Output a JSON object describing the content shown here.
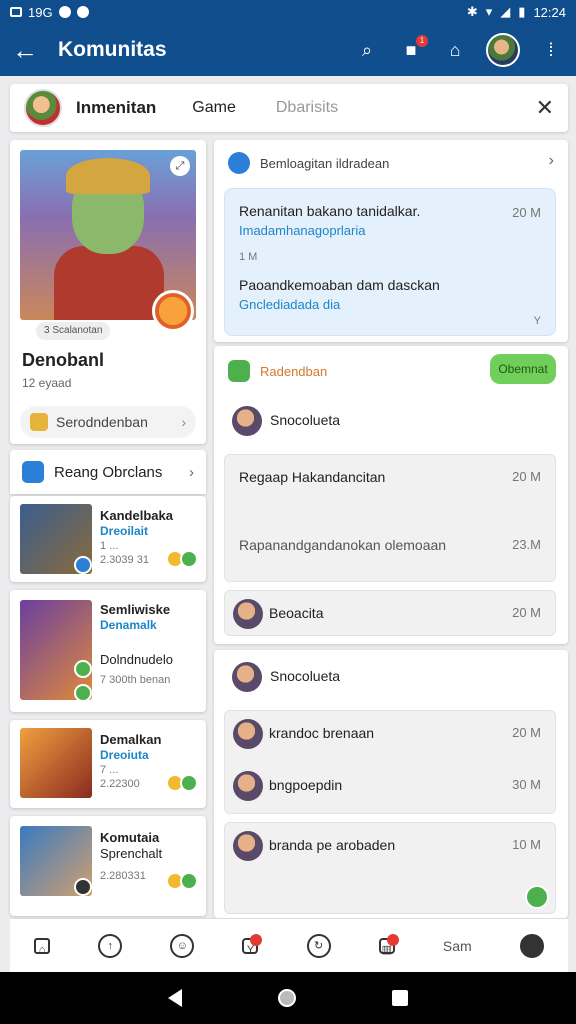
{
  "status_bar": {
    "left_text": "19G",
    "time": "12:24"
  },
  "app_bar": {
    "title": "Komunitas",
    "back_icon": "←",
    "notification_badge": "1"
  },
  "tabs": [
    {
      "label": "Inmenitan"
    },
    {
      "label": "Game"
    },
    {
      "label": "Dbarisits"
    }
  ],
  "profile": {
    "chip": "3 Scalanotan",
    "name": "Denobanl",
    "sub": "12 eyaad",
    "row_label": "Serodndenban"
  },
  "recommend": {
    "title": "Reang Obrclans"
  },
  "games": [
    {
      "title": "Kandelbaka",
      "sub": "Dreoilait",
      "meta1": "1 ...",
      "meta2": "2.3039 31"
    },
    {
      "title": "Semliwiske",
      "sub": "Denamalk",
      "meta1": "Dolndnudelo",
      "meta2": "7 300th benan"
    },
    {
      "title": "Demalkan",
      "sub": "Dreoiuta",
      "meta1": "7 ...",
      "meta2": "2.22300"
    },
    {
      "title": "Komutaia",
      "sub": "Sprenchalt",
      "meta1": "2.280331",
      "meta2": ""
    }
  ],
  "notice": {
    "head": "Bemloagitan ildradean",
    "line1": "Renanitan bakano tanidalkar.",
    "link1": "Imadamhanagoprlaria",
    "time1": "20 M",
    "small": "1 M",
    "line2": "Paoandkemoaban dam dasckan",
    "link2": "Gnclediadada dia",
    "foot": "Y"
  },
  "section1": {
    "head": "Radendban",
    "button": "Obemnat",
    "user": "Snocolueta",
    "item1": {
      "text": "Regaap Hakandancitan",
      "time": "20 M"
    },
    "item2": {
      "text": "Rapanandgandanokan olemoaan",
      "time": "23.M"
    },
    "item3": {
      "text": "Beoacita",
      "time": "20 M"
    }
  },
  "section2": {
    "user": "Snocolueta",
    "item1": {
      "text": "krandoc brenaan",
      "time": "20 M"
    },
    "item2": {
      "text": "bngpoepdin",
      "time": "30 M"
    },
    "item3": {
      "text": "branda pe arobaden",
      "time": "10 M"
    }
  },
  "bottom_nav": {
    "label": "Sam"
  },
  "colors": {
    "primary": "#104e8e",
    "accent_green": "#6fcf5a",
    "link": "#1c86c8"
  }
}
